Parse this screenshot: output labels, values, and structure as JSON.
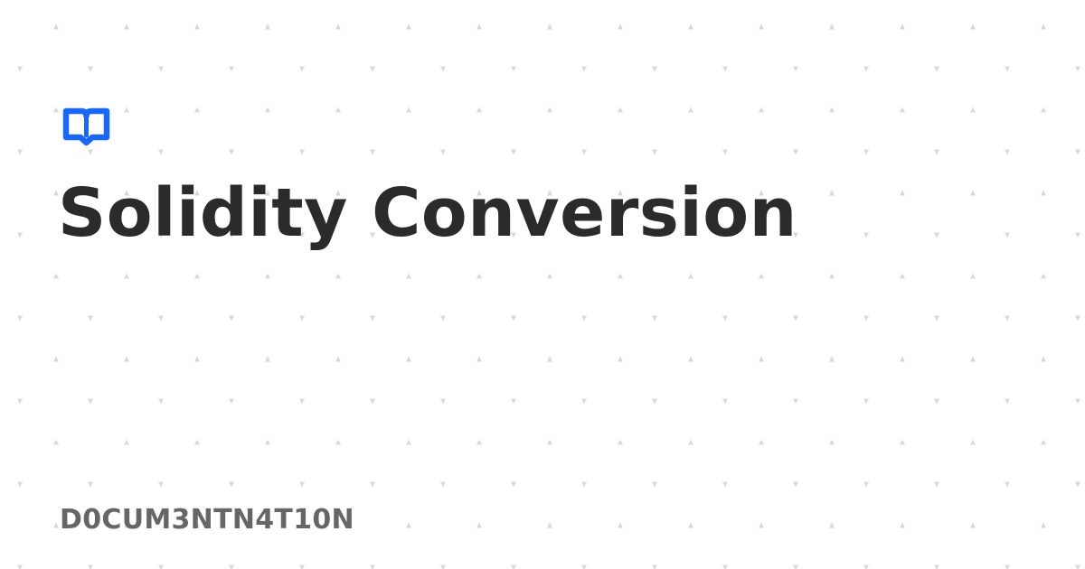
{
  "brand": {
    "icon": "open-book-icon",
    "accent_color": "#1a66f5"
  },
  "title": "Solidity Conversion",
  "footer_label": "D0CUM3NTN4T10N"
}
